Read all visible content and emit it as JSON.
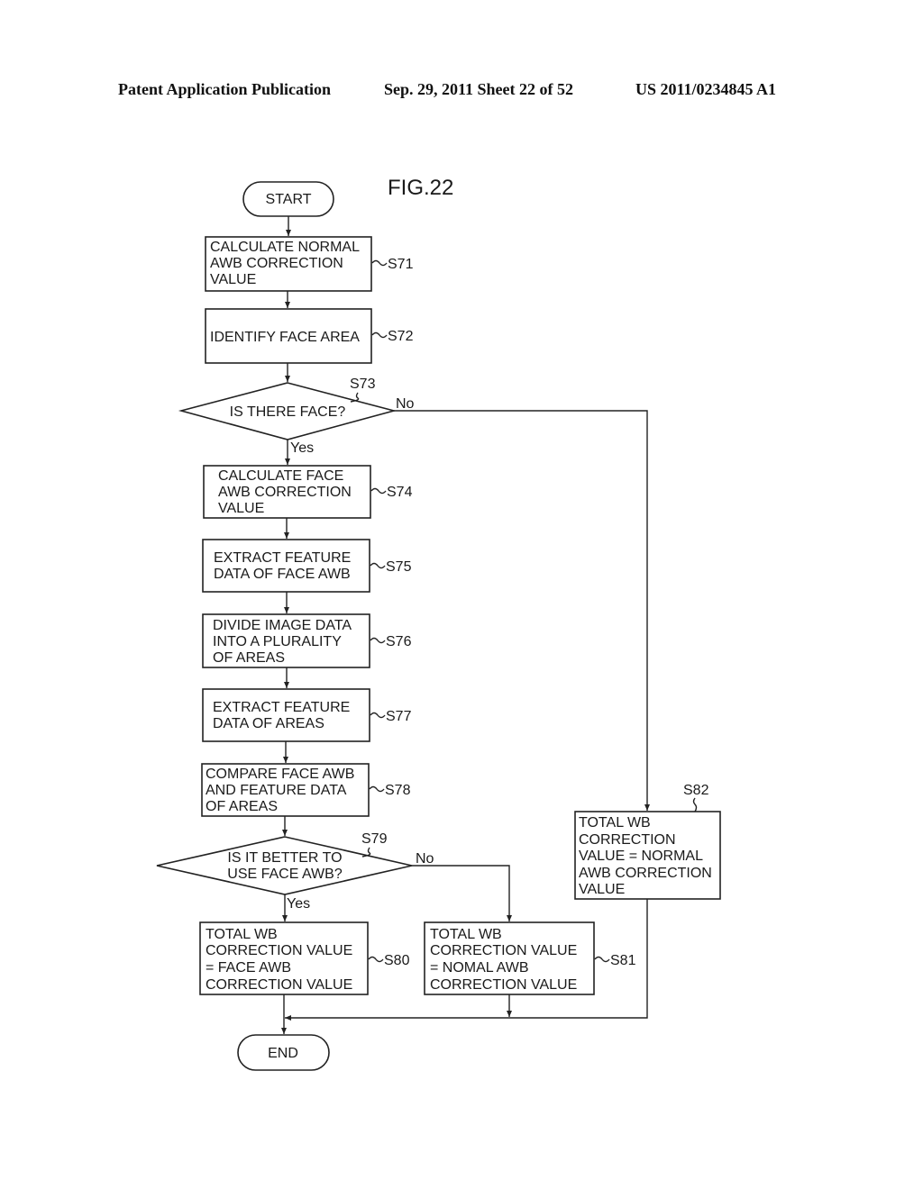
{
  "header": {
    "publication": "Patent Application Publication",
    "date_sheet": "Sep. 29, 2011   Sheet 22 of 52",
    "number": "US 2011/0234845 A1"
  },
  "figure": {
    "title": "FIG.22",
    "start": "START",
    "end": "END",
    "steps": {
      "s71": {
        "id": "S71",
        "lines": [
          "CALCULATE NORMAL",
          "AWB CORRECTION",
          "VALUE"
        ]
      },
      "s72": {
        "id": "S72",
        "lines": [
          "IDENTIFY FACE AREA"
        ]
      },
      "s73": {
        "id": "S73",
        "lines": [
          "IS THERE FACE?"
        ],
        "yes": "Yes",
        "no": "No"
      },
      "s74": {
        "id": "S74",
        "lines": [
          "CALCULATE FACE",
          "AWB CORRECTION",
          "VALUE"
        ]
      },
      "s75": {
        "id": "S75",
        "lines": [
          "EXTRACT FEATURE",
          "DATA OF FACE AWB"
        ]
      },
      "s76": {
        "id": "S76",
        "lines": [
          "DIVIDE IMAGE DATA",
          "INTO A PLURALITY",
          "OF AREAS"
        ]
      },
      "s77": {
        "id": "S77",
        "lines": [
          "EXTRACT FEATURE",
          "DATA OF AREAS"
        ]
      },
      "s78": {
        "id": "S78",
        "lines": [
          "COMPARE FACE AWB",
          "AND FEATURE DATA",
          "OF AREAS"
        ]
      },
      "s79": {
        "id": "S79",
        "lines": [
          "IS IT BETTER TO",
          "USE FACE AWB?"
        ],
        "yes": "Yes",
        "no": "No"
      },
      "s80": {
        "id": "S80",
        "lines": [
          "TOTAL WB",
          "CORRECTION VALUE",
          "= FACE AWB",
          "CORRECTION VALUE"
        ]
      },
      "s81": {
        "id": "S81",
        "lines": [
          "TOTAL WB",
          "CORRECTION VALUE",
          "= NOMAL AWB",
          "CORRECTION VALUE"
        ]
      },
      "s82": {
        "id": "S82",
        "lines": [
          "TOTAL WB",
          "CORRECTION",
          "VALUE = NORMAL",
          "AWB CORRECTION",
          "VALUE"
        ]
      }
    }
  }
}
